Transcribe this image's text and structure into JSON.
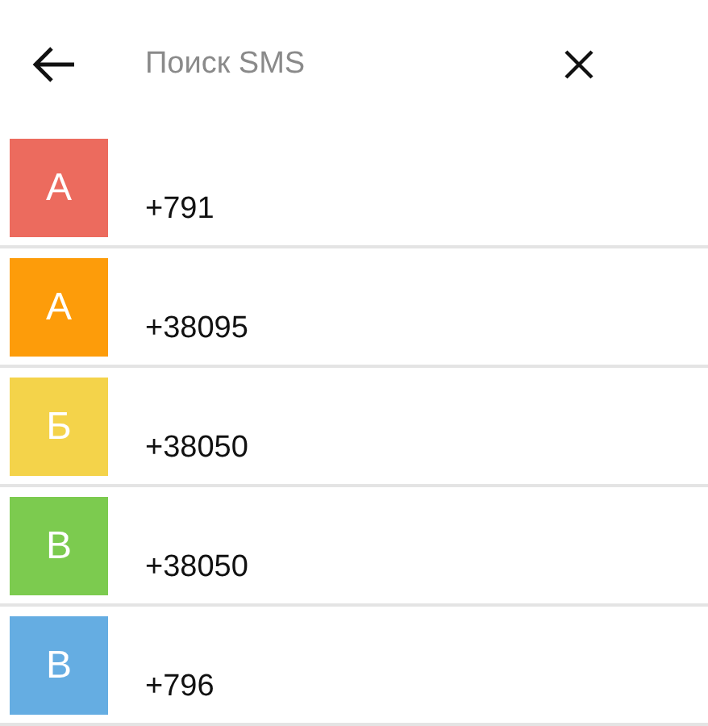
{
  "search": {
    "placeholder": "Поиск SMS"
  },
  "contacts": [
    {
      "initial": "А",
      "color": "#ec6b5e",
      "number": "+791"
    },
    {
      "initial": "А",
      "color": "#fd9c0a",
      "number": "+38095"
    },
    {
      "initial": "Б",
      "color": "#f4d34a",
      "number": "+38050"
    },
    {
      "initial": "В",
      "color": "#7ccb4f",
      "number": "+38050"
    },
    {
      "initial": "В",
      "color": "#65ade2",
      "number": "+796"
    }
  ]
}
